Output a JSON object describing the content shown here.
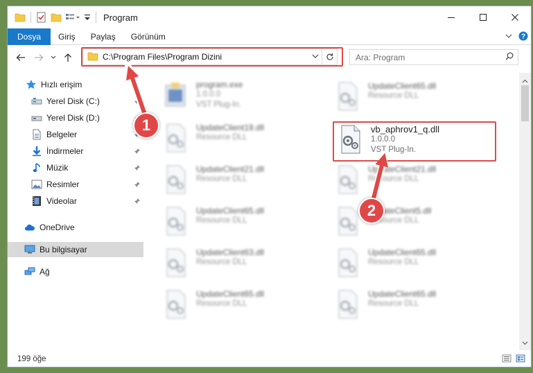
{
  "window": {
    "title": "Program"
  },
  "ribbon": {
    "tabs": [
      {
        "label": "Dosya"
      },
      {
        "label": "Giriş"
      },
      {
        "label": "Paylaş"
      },
      {
        "label": "Görünüm"
      }
    ]
  },
  "address": {
    "path": "C:\\Program Files\\Program Dizini"
  },
  "search": {
    "placeholder": "Ara: Program"
  },
  "sidebar": {
    "items": [
      {
        "label": "Hızlı erişim",
        "icon": "star-icon"
      },
      {
        "label": "Yerel Disk (C:)",
        "icon": "drive-icon",
        "pinned": true
      },
      {
        "label": "Yerel Disk (D:)",
        "icon": "drive-icon",
        "pinned": true
      },
      {
        "label": "Belgeler",
        "icon": "documents-icon",
        "pinned": true
      },
      {
        "label": "İndirmeler",
        "icon": "download-icon",
        "pinned": true
      },
      {
        "label": "Müzik",
        "icon": "music-icon",
        "pinned": true
      },
      {
        "label": "Resimler",
        "icon": "pictures-icon",
        "pinned": true
      },
      {
        "label": "Videolar",
        "icon": "videos-icon",
        "pinned": true
      },
      {
        "label": "OneDrive",
        "icon": "cloud-icon"
      },
      {
        "label": "Bu bilgisayar",
        "icon": "computer-icon",
        "selected": true
      },
      {
        "label": "Ağ",
        "icon": "network-icon"
      }
    ]
  },
  "files": {
    "left": [
      {
        "name": "program.exe",
        "line2": "1.0.0.0",
        "line3": "VST Plug-In."
      },
      {
        "name": "UpdateClient19.dll",
        "line2": "Resource DLL"
      },
      {
        "name": "UpdateClient21.dll",
        "line2": "Resource DLL"
      },
      {
        "name": "UpdateClient65.dll",
        "line2": "Resource DLL"
      },
      {
        "name": "UpdateClient63.dll",
        "line2": "Resource DLL"
      },
      {
        "name": "UpdateClient65.dll",
        "line2": "Resource DLL"
      }
    ],
    "right": [
      {
        "name": "UpdateClient65.dll",
        "line2": "Resource DLL"
      },
      {
        "name": "vb_aphrov1_q.dll",
        "line2": "1.0.0.0",
        "line3": "VST Plug-In."
      },
      {
        "name": "UpdateClient21.dll",
        "line2": "Resource DLL"
      },
      {
        "name": "UpdateClient5.dll",
        "line2": "Resource DLL"
      },
      {
        "name": "UpdateClient65.dll",
        "line2": "Resource DLL"
      },
      {
        "name": "UpdateClient65.dll",
        "line2": "Resource DLL"
      }
    ]
  },
  "status": {
    "count": "199 öğe"
  },
  "annotations": {
    "badge1": "1",
    "badge2": "2"
  },
  "colors": {
    "accent": "#1979ca",
    "highlight": "#e04848"
  }
}
